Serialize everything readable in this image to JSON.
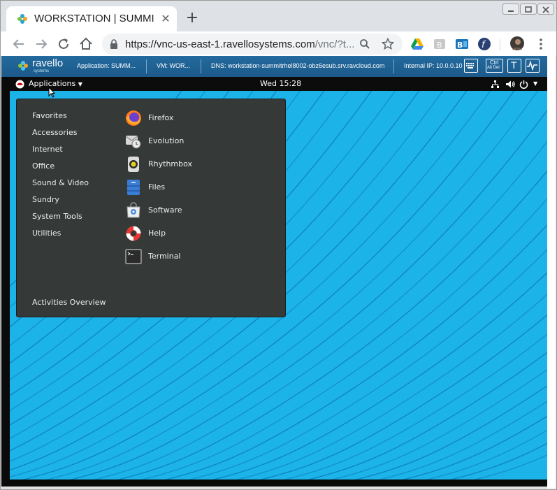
{
  "browser": {
    "tab_title": "WORKSTATION | SUMMI",
    "tab_close": "✕",
    "new_tab": "+",
    "url_host": "https://vnc-us-east-1.ravellosystems.com",
    "url_path": "/vnc/?t..."
  },
  "ravello": {
    "brand": "ravello",
    "brand_sub": "systems",
    "application": "Application: SUMM...",
    "vm": "VM: WOR...",
    "dns": "DNS: workstation-summitrhel8002-obz6esub.srv.ravcloud.com",
    "internal_ip": "Internal IP: 10.0.0.10",
    "ctrl_label_top": "Ctrl",
    "ctrl_label_bottom": "Alt Del",
    "text_button": "T"
  },
  "gnome": {
    "applications_label": "Applications",
    "clock": "Wed 15:28"
  },
  "menu": {
    "categories": [
      "Favorites",
      "Accessories",
      "Internet",
      "Office",
      "Sound & Video",
      "Sundry",
      "System Tools",
      "Utilities"
    ],
    "apps": [
      {
        "label": "Firefox",
        "icon": "firefox-icon"
      },
      {
        "label": "Evolution",
        "icon": "evolution-icon"
      },
      {
        "label": "Rhythmbox",
        "icon": "rhythmbox-icon"
      },
      {
        "label": "Files",
        "icon": "files-icon"
      },
      {
        "label": "Software",
        "icon": "software-icon"
      },
      {
        "label": "Help",
        "icon": "help-icon"
      },
      {
        "label": "Terminal",
        "icon": "terminal-icon"
      }
    ],
    "activities": "Activities Overview"
  }
}
